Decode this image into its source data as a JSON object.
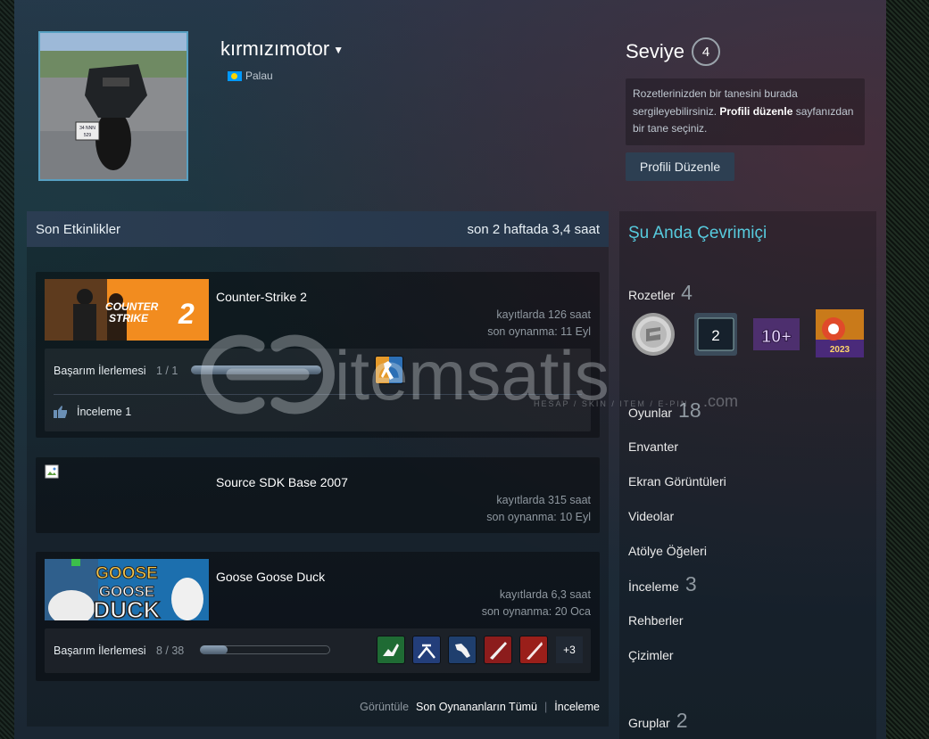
{
  "profile": {
    "name": "kırmızımotor",
    "country": "Palau",
    "level_label": "Seviye",
    "level": "4",
    "showcase_text_1": "Rozetlerinizden bir tanesini burada sergileyebilirsiniz. ",
    "showcase_link": "Profili düzenle",
    "showcase_text_2": " sayfanızdan bir tane seçiniz.",
    "edit_button": "Profili Düzenle",
    "avatar_plate_1": "34 NNN",
    "avatar_plate_2": "529"
  },
  "recent": {
    "title": "Son Etkinlikler",
    "hours_summary": "son 2 haftada 3,4 saat",
    "games": [
      {
        "name": "Counter-Strike 2",
        "hours": "kayıtlarda 126 saat",
        "last_played": "son oynanma: 11 Eyl",
        "banner_text_1": "COUNTER",
        "banner_text_2": "STRIKE",
        "ach_label": "Başarım İlerlemesi",
        "ach_count": "1 / 1",
        "ach_progress": 1.0,
        "review_label": "İnceleme 1"
      },
      {
        "name": "Source SDK Base 2007",
        "hours": "kayıtlarda 315 saat",
        "last_played": "son oynanma: 10 Eyl"
      },
      {
        "name": "Goose Goose Duck",
        "hours": "kayıtlarda 6,3 saat",
        "last_played": "son oynanma: 20 Oca",
        "banner_text_1": "GOOSE",
        "banner_text_2": "GOOSE",
        "banner_text_3": "DUCK",
        "ach_label": "Başarım İlerlemesi",
        "ach_count": "8 / 38",
        "ach_progress": 0.21,
        "more_achievements": "+3"
      }
    ],
    "footer_view": "Görüntüle",
    "footer_all": "Son Oynananların Tümü",
    "footer_review": "İnceleme"
  },
  "sidebar": {
    "status": "Şu Anda Çevrimiçi",
    "badges_label": "Rozetler",
    "badges_count": "4",
    "badge_2_text": "2",
    "badge_3_text": "10+",
    "badge_4_text": "2023",
    "games_label": "Oyunlar",
    "games_count": "18",
    "inventory": "Envanter",
    "screenshots": "Ekran Görüntüleri",
    "videos": "Videolar",
    "workshop": "Atölye Öğeleri",
    "reviews_label": "İnceleme",
    "reviews_count": "3",
    "guides": "Rehberler",
    "artwork": "Çizimler",
    "groups_label": "Gruplar",
    "groups_count": "2"
  },
  "watermark": {
    "brand": "itemsatis",
    "tagline": "HESAP / SKIN / ITEM / E-PIN",
    "domain": ".com"
  },
  "colors": {
    "online": "#57cbde",
    "cs2_banner": "#f28c1f",
    "avatar_border": "#57a0c2"
  }
}
